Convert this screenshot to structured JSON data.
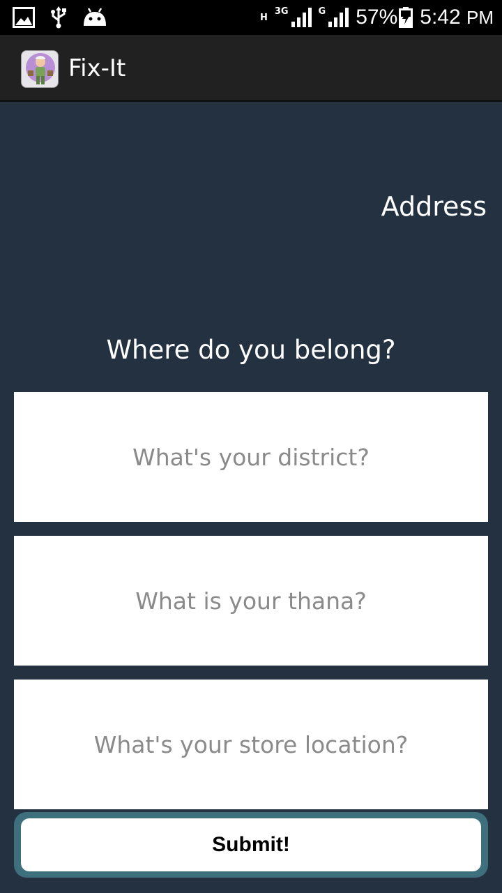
{
  "status_bar": {
    "network_1": "H",
    "network_2": "3G",
    "network_3": "G",
    "battery": "57%",
    "time": "5:42",
    "ampm": "PM",
    "icons": [
      "image-icon",
      "usb-icon",
      "android-icon",
      "signal-icon",
      "battery-charging-icon"
    ]
  },
  "app_bar": {
    "title": "Fix-It",
    "logo_icon": "fixit-logo-icon"
  },
  "main": {
    "section_title": "Address",
    "question": "Where do you belong?",
    "fields": {
      "district_placeholder": "What's your district?",
      "thana_placeholder": "What is your thana?",
      "store_placeholder": "What's your store location?"
    },
    "submit_label": "Submit!"
  },
  "colors": {
    "background": "#233140",
    "app_bar": "#212121",
    "button_frame": "#3e6f7c"
  }
}
